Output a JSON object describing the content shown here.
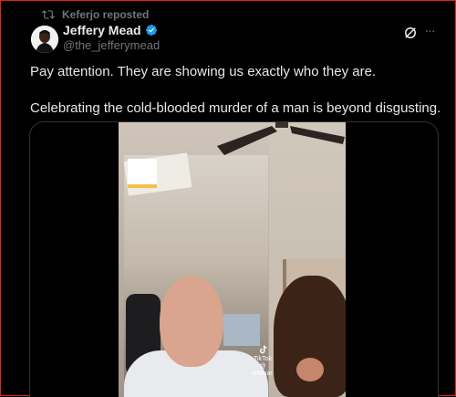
{
  "repost": {
    "label": "Keferjo reposted",
    "icon": "repost-icon"
  },
  "author": {
    "name": "Jeffery Mead",
    "handle": "@the_jefferymead",
    "verified_icon": "verified-badge-icon"
  },
  "actions": {
    "grok_icon": "grok-icon",
    "more_label": "···"
  },
  "tweet": {
    "paragraphs": [
      "Pay attention. They are showing us exactly who they are.",
      "Celebrating the cold-blooded murder of a man is beyond disgusting."
    ]
  },
  "media": {
    "watermark": {
      "brand": "TikTok",
      "handle": "@ tobhjar"
    }
  },
  "colors": {
    "accent": "#1d9bf0",
    "secondary_text": "#71767b",
    "frame": "#e2231a"
  }
}
